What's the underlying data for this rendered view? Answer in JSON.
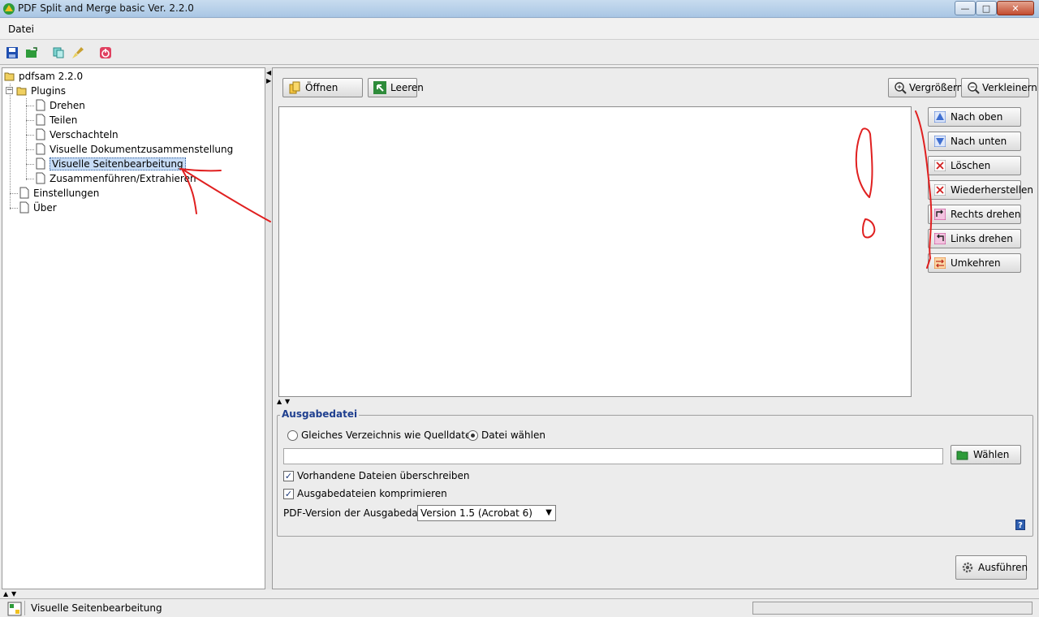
{
  "window": {
    "title": "PDF Split and Merge basic Ver. 2.2.0",
    "min_glyph": "—",
    "max_glyph": "□",
    "close_glyph": "✕"
  },
  "menu": {
    "items": [
      {
        "label": "Datei"
      }
    ]
  },
  "toolbar": {
    "icons": [
      "save-icon",
      "open-folder-icon",
      "copy-icon",
      "clean-brush-icon",
      "power-exit-icon"
    ]
  },
  "tree": {
    "root": "pdfsam 2.2.0",
    "plugins_label": "Plugins",
    "plugins": [
      {
        "label": "Drehen"
      },
      {
        "label": "Teilen"
      },
      {
        "label": "Verschachteln"
      },
      {
        "label": "Visuelle Dokumentzusammenstellung"
      },
      {
        "label": "Visuelle Seitenbearbeitung",
        "selected": true
      },
      {
        "label": "Zusammenführen/Extrahieren"
      }
    ],
    "settings": "Einstellungen",
    "about": "Über"
  },
  "top_buttons": {
    "open": "Öffnen",
    "clear": "Leeren",
    "zoom_in": "Vergrößern",
    "zoom_out": "Verkleinern"
  },
  "side_buttons": [
    {
      "label": "Nach oben",
      "icon": "move-up-icon",
      "color": "#3f6fd0"
    },
    {
      "label": "Nach unten",
      "icon": "move-down-icon",
      "color": "#3f6fd0"
    },
    {
      "label": "Löschen",
      "icon": "delete-icon",
      "color": "#d02020"
    },
    {
      "label": "Wiederherstellen",
      "icon": "undelete-icon",
      "color": "#d02020"
    },
    {
      "label": "Rechts drehen",
      "icon": "rotate-right-icon",
      "color": "#c03c8c"
    },
    {
      "label": "Links drehen",
      "icon": "rotate-left-icon",
      "color": "#c03c8c"
    },
    {
      "label": "Umkehren",
      "icon": "reverse-icon",
      "color": "#e07020"
    }
  ],
  "output": {
    "legend": "Ausgabedatei",
    "radio_same_dir": "Gleiches Verzeichnis wie Quelldatei",
    "radio_choose_file": "Datei wählen",
    "radio_selected": "choose_file",
    "path_value": "",
    "choose_button": "Wählen",
    "overwrite_label": "Vorhandene Dateien überschreiben",
    "overwrite_checked": true,
    "compress_label": "Ausgabedateien komprimieren",
    "compress_checked": true,
    "pdf_version_label": "PDF-Version der Ausgabedatei:",
    "pdf_version_value": "Version 1.5 (Acrobat 6)",
    "help_glyph": "?"
  },
  "run_button": "Ausführen",
  "status": {
    "text": "Visuelle Seitenbearbeitung",
    "progress": 0
  },
  "colors": {
    "accent": "#2f5fb0",
    "annotation": "#e02020",
    "selection": "#c6dbf5"
  }
}
